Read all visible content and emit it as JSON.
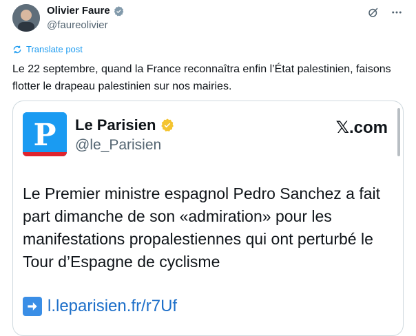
{
  "author": {
    "name": "Olivier Faure",
    "handle": "@faureolivier"
  },
  "translate_label": "Translate post",
  "tweet_text": "Le 22 septembre, quand la France reconnaîtra enfin l’État palestinien, faisons flotter le drapeau palestinien sur nos mairies.",
  "card": {
    "brand_name": "Le Parisien",
    "brand_handle": "@le_Parisien",
    "platform": "𝕏.com",
    "headline": "Le Premier ministre espagnol Pedro Sanchez a fait part dimanche de son «admiration» pour les manifestations propalestiennes qui ont perturbé le Tour d’Espagne de cyclisme",
    "link_text": "l.leparisien.fr/r7Uf"
  },
  "colors": {
    "accent": "#1d9bf0",
    "verified_gold": "#f4c430",
    "verified_gray": "#829aab",
    "link": "#1d6fc9"
  },
  "icons": [
    "verified-icon",
    "grok-icon",
    "more-icon",
    "translate-icon",
    "arrow-right-icon"
  ]
}
